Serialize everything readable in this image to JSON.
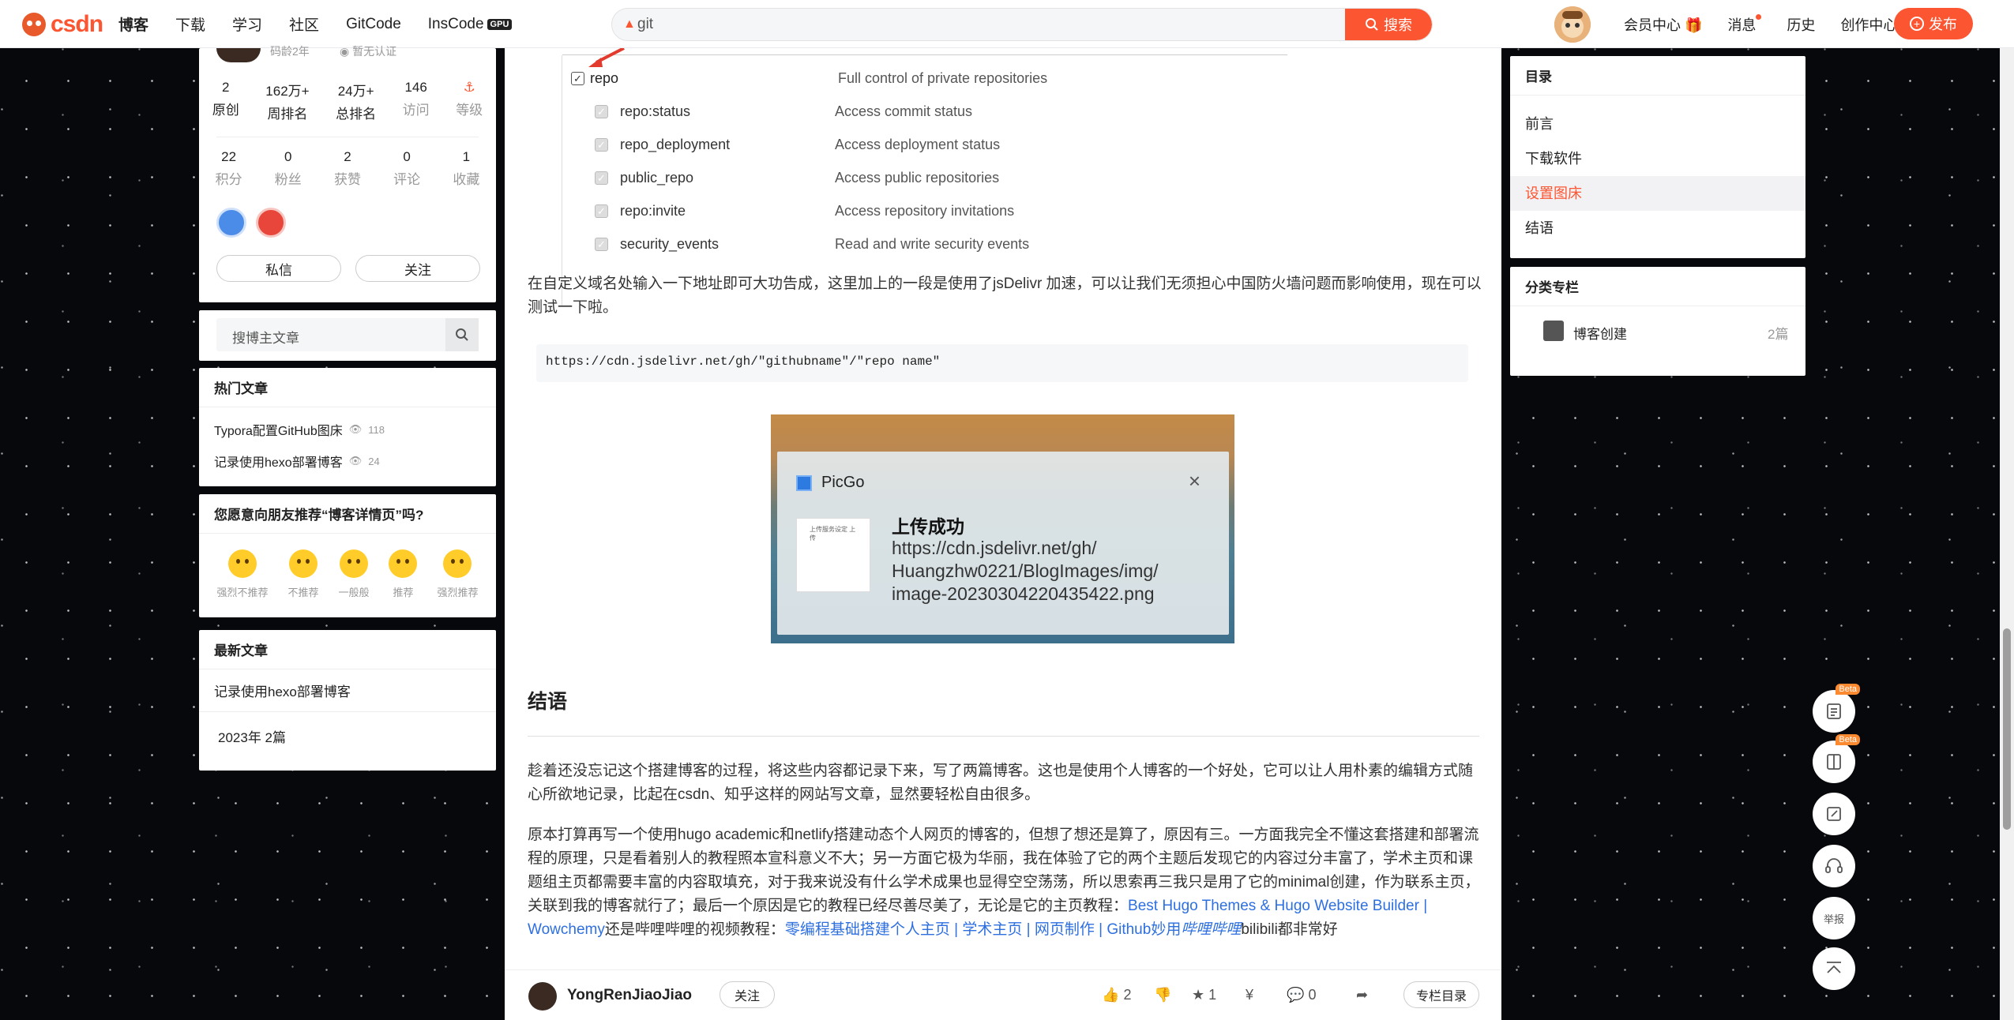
{
  "header": {
    "logo": "CSDN",
    "nav": [
      "博客",
      "下载",
      "学习",
      "社区",
      "GitCode",
      "InsCode"
    ],
    "gpu_badge": "GPU",
    "search_value": "git",
    "search_btn": "搜索",
    "right_nav": [
      "会员中心",
      "消息",
      "历史",
      "创作中心"
    ],
    "publish": "发布"
  },
  "profile": {
    "code_age": "码龄2年",
    "verify": "暂无认证",
    "stats_row1": [
      {
        "v": "2",
        "l": "原创"
      },
      {
        "v": "162万+",
        "l": "周排名"
      },
      {
        "v": "24万+",
        "l": "总排名"
      },
      {
        "v": "146",
        "l": "访问"
      },
      {
        "v": "",
        "l": "等级"
      }
    ],
    "stats_row2": [
      {
        "v": "22",
        "l": "积分"
      },
      {
        "v": "0",
        "l": "粉丝"
      },
      {
        "v": "2",
        "l": "获赞"
      },
      {
        "v": "0",
        "l": "评论"
      },
      {
        "v": "1",
        "l": "收藏"
      }
    ],
    "message_btn": "私信",
    "follow_btn": "关注"
  },
  "blog_search": {
    "placeholder": "搜博主文章"
  },
  "hot": {
    "title": "热门文章",
    "items": [
      {
        "title": "Typora配置GitHub图床",
        "views": "118"
      },
      {
        "title": "记录使用hexo部署博客",
        "views": "24"
      }
    ]
  },
  "recommend": {
    "title": "您愿意向朋友推荐“博客详情页”吗?",
    "options": [
      "强烈不推荐",
      "不推荐",
      "一般般",
      "推荐",
      "强烈推荐"
    ]
  },
  "latest": {
    "title": "最新文章",
    "items": [
      "记录使用hexo部署博客"
    ],
    "archive": "2023年  2篇"
  },
  "article": {
    "permissions": [
      {
        "name": "repo",
        "desc": "Full control of private repositories",
        "checked": true
      },
      {
        "name": "repo:status",
        "desc": "Access commit status"
      },
      {
        "name": "repo_deployment",
        "desc": "Access deployment status"
      },
      {
        "name": "public_repo",
        "desc": "Access public repositories"
      },
      {
        "name": "repo:invite",
        "desc": "Access repository invitations"
      },
      {
        "name": "security_events",
        "desc": "Read and write security events"
      }
    ],
    "para1": "在自定义域名处输入一下地址即可大功告成，这里加上的一段是使用了jsDelivr 加速，可以让我们无须担心中国防火墙问题而影响使用，现在可以测试一下啦。",
    "code": "https://cdn.jsdelivr.net/gh/\"githubname\"/\"repo name\"",
    "picgo": {
      "app": "PicGo",
      "title": "上传成功",
      "thumb_text": "上传服务设定  上传",
      "url_lines": [
        "https://cdn.jsdelivr.net/gh/",
        "Huangzhw0221/BlogImages/img/",
        "image-20230304220435422.png"
      ]
    },
    "section": "结语",
    "para2": "趁着还没忘记这个搭建博客的过程，将这些内容都记录下来，写了两篇博客。这也是使用个人博客的一个好处，它可以让人用朴素的编辑方式随心所欲地记录，比起在csdn、知乎这样的网站写文章，显然要轻松自由很多。",
    "para3_a": "原本打算再写一个使用hugo academic和netlify搭建动态个人网页的博客的，但想了想还是算了，原因有三。一方面我完全不懂这套搭建和部署流程的原理，只是看着别人的教程照本宣科意义不大；另一方面它极为华丽，我在体验了它的两个主题后发现它的内容过分丰富了，学术主页和课题组主页都需要丰富的内容取填充，对于我来说没有什么学术成果也显得空空荡荡，所以思索再三我只是用了它的minimal创建，作为联系主页，关联到我的博客就行了；最后一个原因是它的教程已经尽善尽美了，无论是它的主页教程：",
    "link1": "Best Hugo Themes & Hugo Website Builder | Wowchemy",
    "para3_b": "还是哔哩哔哩的视频教程：",
    "link2": "零编程基础搭建个人主页 | 学术主页 | 网页制作 | Github妙用",
    "link3": "哔哩哔哩",
    "para3_c": "bilibili都非常好"
  },
  "bottom": {
    "author": "YongRenJiaoJiao",
    "follow": "关注",
    "likes": "2",
    "collects": "1",
    "comments": "0",
    "column": "专栏目录"
  },
  "toc": {
    "title": "目录",
    "items": [
      "前言",
      "下载软件",
      "设置图床",
      "结语"
    ],
    "active_index": 2
  },
  "category": {
    "title": "分类专栏",
    "items": [
      {
        "name": "博客创建",
        "count": "2篇"
      }
    ]
  },
  "float": {
    "report": "举报",
    "beta": "Beta"
  }
}
